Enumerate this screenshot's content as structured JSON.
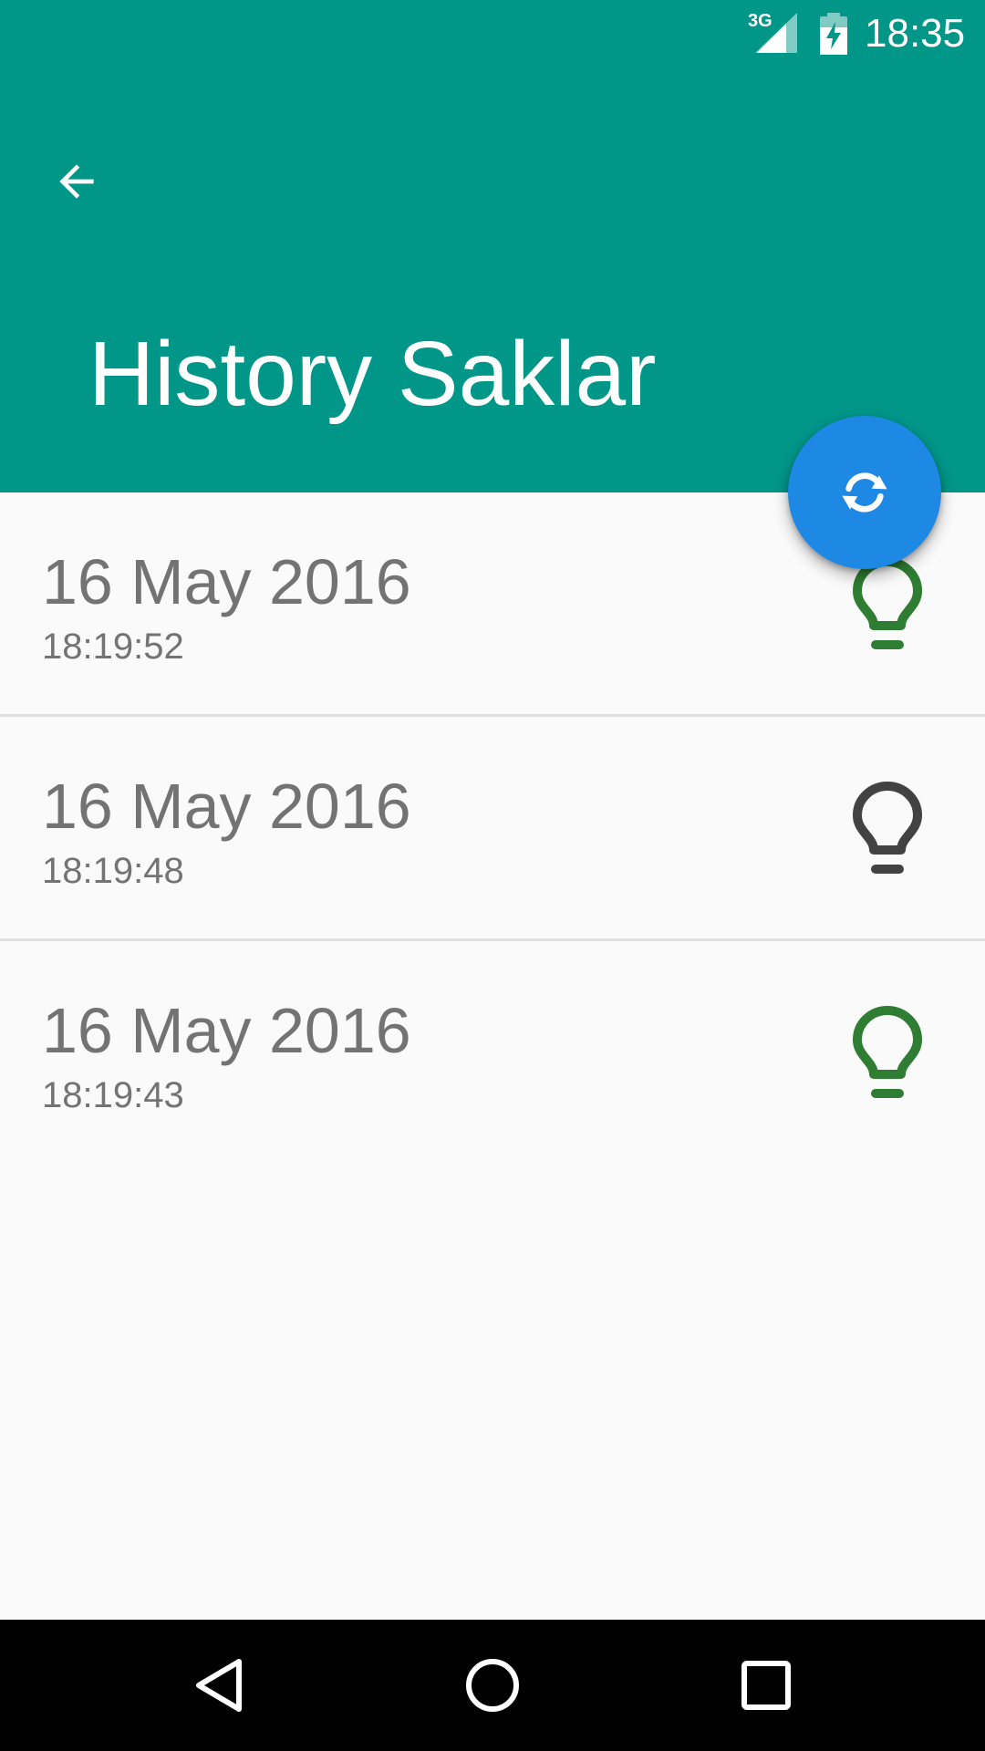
{
  "status_bar": {
    "network": "3G",
    "time": "18:35"
  },
  "app_bar": {
    "title": "History Saklar"
  },
  "history": [
    {
      "date": "16 May 2016",
      "time": "18:19:52",
      "status": "on"
    },
    {
      "date": "16 May 2016",
      "time": "18:19:48",
      "status": "off"
    },
    {
      "date": "16 May 2016",
      "time": "18:19:43",
      "status": "on"
    }
  ],
  "icons": {
    "back": "arrow-left-icon",
    "fab": "refresh-icon",
    "bulb": "lightbulb-icon"
  },
  "colors": {
    "primary": "#009688",
    "fab": "#1e88e5",
    "bulb_on": "#2e7d32",
    "bulb_off": "#424242",
    "text_secondary": "#737373"
  }
}
